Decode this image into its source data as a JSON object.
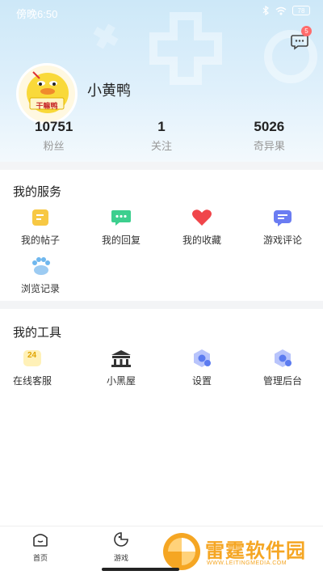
{
  "status_bar": {
    "time": "傍晚6:50",
    "battery": "78"
  },
  "header": {
    "message_badge": "5",
    "avatar_text": "干嘛鸭",
    "username": "小黄鸭"
  },
  "stats": [
    {
      "value": "10751",
      "label": "粉丝"
    },
    {
      "value": "1",
      "label": "关注"
    },
    {
      "value": "5026",
      "label": "奇异果"
    }
  ],
  "services": {
    "title": "我的服务",
    "items": [
      {
        "label": "我的帖子",
        "icon": "post-icon"
      },
      {
        "label": "我的回复",
        "icon": "reply-icon"
      },
      {
        "label": "我的收藏",
        "icon": "heart-icon"
      },
      {
        "label": "游戏评论",
        "icon": "comment-icon"
      },
      {
        "label": "浏览记录",
        "icon": "paw-icon"
      }
    ]
  },
  "tools": {
    "title": "我的工具",
    "items": [
      {
        "label": "在线客服",
        "icon": "24h-icon",
        "icon_text": "24"
      },
      {
        "label": "小黑屋",
        "icon": "house-icon"
      },
      {
        "label": "设置",
        "icon": "settings-icon"
      },
      {
        "label": "管理后台",
        "icon": "admin-icon"
      }
    ]
  },
  "tabbar": [
    {
      "label": "首页",
      "icon": "home-icon"
    },
    {
      "label": "游戏",
      "icon": "game-icon"
    }
  ],
  "watermark": {
    "text": "雷霆软件园",
    "sub": "WWW.LEITINGMEDIA.COM"
  },
  "colors": {
    "accent_blue": "#5b7bf0",
    "header_bg": "#cde8f8",
    "badge_red": "#ff6b6b",
    "heart_red": "#f0454a",
    "green": "#3ccf8e",
    "yellow": "#f7c843",
    "watermark_orange": "#f5a623"
  }
}
